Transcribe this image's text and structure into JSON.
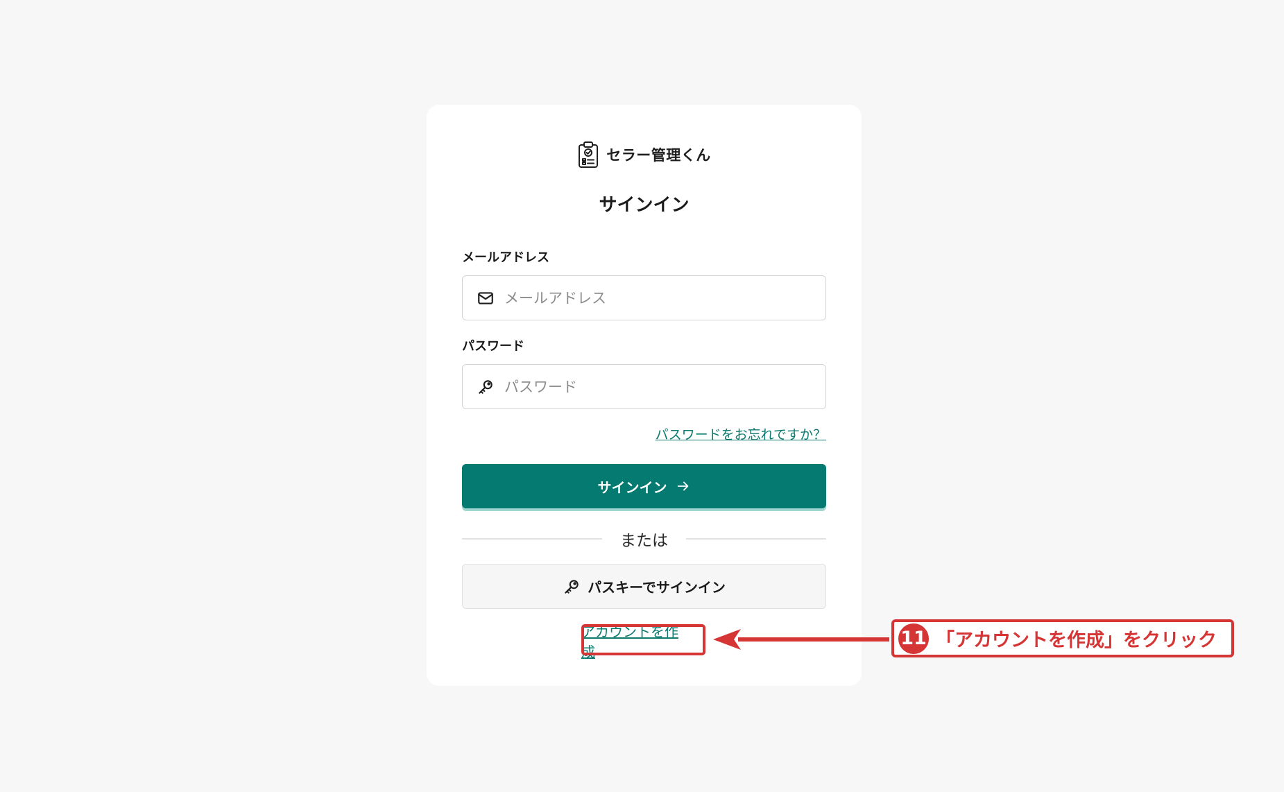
{
  "app": {
    "name": "セラー管理くん"
  },
  "signin": {
    "title": "サインイン",
    "email": {
      "label": "メールアドレス",
      "placeholder": "メールアドレス",
      "value": ""
    },
    "password": {
      "label": "パスワード",
      "placeholder": "パスワード",
      "value": ""
    },
    "forgot_link": "パスワードをお忘れですか？",
    "submit_label": "サインイン",
    "divider_text": "または",
    "passkey_label": "パスキーでサインイン",
    "create_account_link": "アカウントを作成"
  },
  "annotation": {
    "step": "11",
    "text": "「アカウントを作成」をクリック",
    "color": "#d63535"
  },
  "colors": {
    "primary": "#047a70",
    "link": "#0d7a70",
    "background": "#f7f7f7"
  },
  "icons": {
    "brand": "clipboard-check-icon",
    "email": "mail-icon",
    "password": "key-icon",
    "submit": "arrow-right-icon",
    "passkey": "key-icon"
  }
}
